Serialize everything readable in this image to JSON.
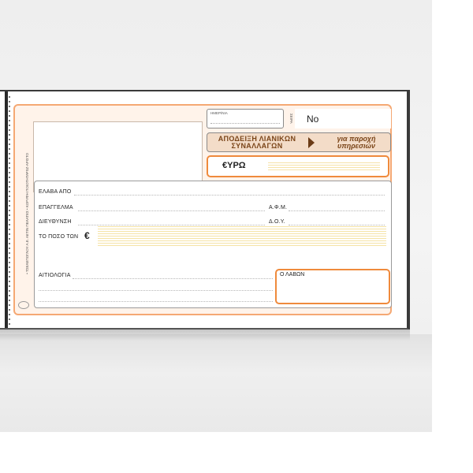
{
  "form": {
    "side_text": [
      "PSZ-ΑΡΙΣΤΟ",
      "ΑΕΤΙΝ ΠΕΛΑΤΕΣ • ΚΟΡΥΦΗ ΠΟΙΟΤΗΤΑ",
      "• ΤΣΕΛΕΠΟΓΛΟΥ Α.Ε."
    ],
    "date_label": "ΗΜΕΡ/ΝΙΑ",
    "series_label": "ΣΕΙΡΑ",
    "number_label": "Νο",
    "title_main": [
      "ΑΠΟΔΕΙΞΗ ΛΙΑΝΙΚΩΝ",
      "ΣΥΝΑΛΛΑΓΩΝ"
    ],
    "title_sub": [
      "για παροχή",
      "υπηρεσιών"
    ],
    "currency_label": "€ΥΡΩ",
    "fields": {
      "received_from": "ΕΛΑΒΑ ΑΠΟ",
      "profession": "ΕΠΑΓΓΕΛΜΑ",
      "afm": "Α.Φ.Μ.",
      "address": "ΔΙΕΥΘΥΝΣΗ",
      "doy": "Δ.Ο.Υ.",
      "amount_of": "ΤΟ ΠΟΣΟ ΤΩΝ",
      "euro_sign": "€",
      "reason": "ΑΙΤΙΟΛΟΓΙΑ",
      "receiver": "Ο ΛΑΒΩΝ"
    }
  },
  "colors": {
    "accent_orange": "#ef8a3c",
    "form_tint": "#fff3ea",
    "title_band": "#f3dcc8",
    "title_text": "#7a4418"
  },
  "icons": {
    "recycle": "recycle-icon",
    "arrow": "triangle-right-icon"
  }
}
